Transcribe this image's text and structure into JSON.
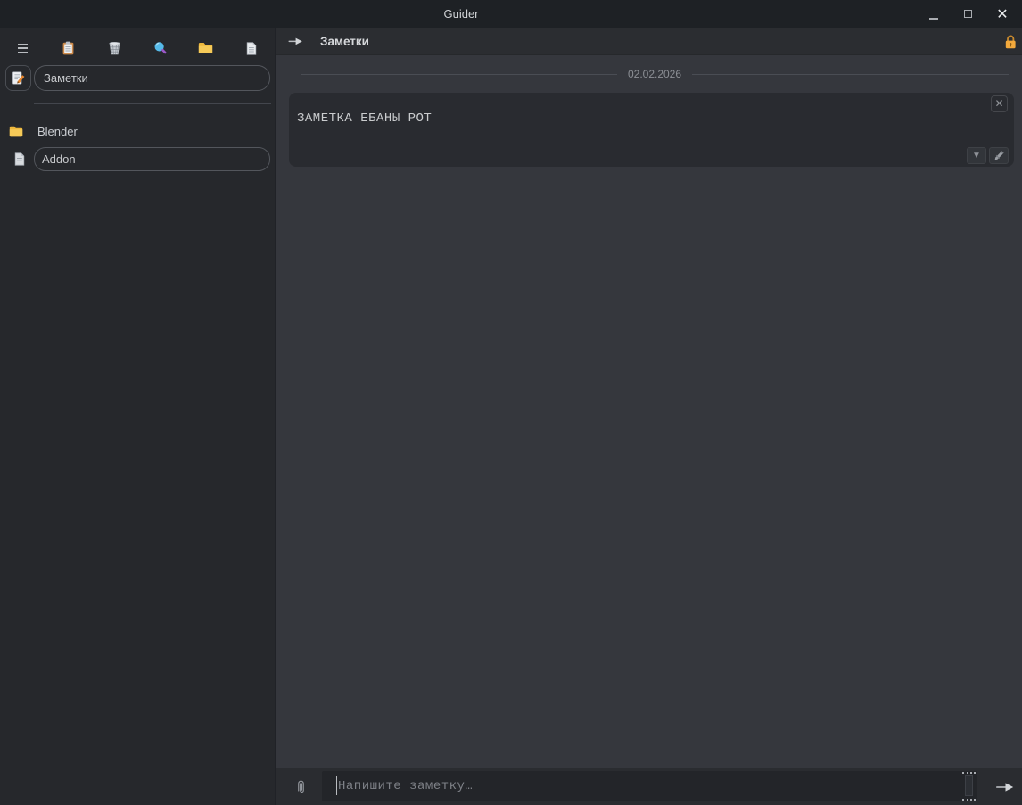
{
  "titlebar": {
    "title": "Guider",
    "close_glyph": "✕"
  },
  "sidebar": {
    "toolbar_icons": [
      "hamburger-menu",
      "clipboard",
      "wastebasket",
      "search",
      "folder",
      "document"
    ],
    "title_field": {
      "icon": "memo",
      "value": "Заметки"
    },
    "tree": [
      {
        "icon": "folder",
        "label": "Blender"
      },
      {
        "icon": "document",
        "label": "Addon"
      }
    ]
  },
  "main": {
    "header": {
      "title": "Заметки",
      "left_icon": "arrow",
      "right_icon": "lock"
    },
    "date_divider": "02.02.2026",
    "note": {
      "text": "ЗАМЕТКА ЕБАНЫ РОТ",
      "close_glyph": "✕",
      "collapse_glyph": "▼"
    },
    "composer": {
      "placeholder": "Напишите заметку…",
      "attach_icon": "paperclip",
      "send_icon": "send-arrow"
    }
  },
  "colors": {
    "titlebar_bg": "#1e2125",
    "sidebar_bg": "#26282c",
    "main_bg": "#35373d",
    "header_bg": "#2b2d31",
    "card_bg": "#292b30",
    "composer_bar_bg": "#2a2c30",
    "composer_input_bg": "#232529",
    "border_gray": "#53565c",
    "text_primary": "#d3d5d8",
    "text_muted": "#8c8f95",
    "lock_orange": "#f3a93c",
    "folder_yellow": "#f2bf45",
    "search_blue": "#55bae9",
    "search_handle_purple": "#9b59c9"
  }
}
